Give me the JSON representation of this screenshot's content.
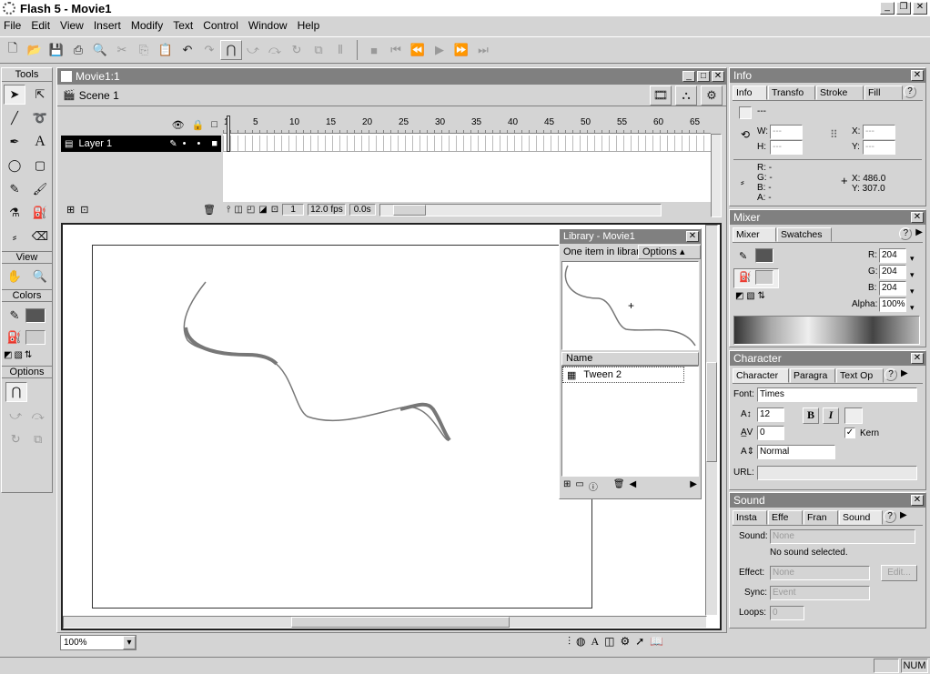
{
  "app": {
    "title": "Flash 5 - Movie1"
  },
  "menu": [
    "File",
    "Edit",
    "View",
    "Insert",
    "Modify",
    "Text",
    "Control",
    "Window",
    "Help"
  ],
  "movie": {
    "title": "Movie1:1",
    "scene": "Scene 1",
    "layer": "Layer 1",
    "frame_numbers": [
      "1",
      "5",
      "10",
      "15",
      "20",
      "25",
      "30",
      "35",
      "40",
      "45",
      "50",
      "55",
      "60",
      "65"
    ],
    "current_frame": "1",
    "fps": "12.0 fps",
    "time": "0.0s",
    "zoom": "100%"
  },
  "tools": {
    "title": "Tools",
    "view": "View",
    "colors": "Colors",
    "options": "Options"
  },
  "info": {
    "title": "Info",
    "tabs": [
      "Info",
      "Transfo",
      "Stroke",
      "Fill"
    ],
    "w_label": "W:",
    "h_label": "H:",
    "x_label": "X:",
    "y_label": "Y:",
    "w": "---",
    "h": "---",
    "x": "---",
    "y": "---",
    "r": "R: -",
    "g": "G: -",
    "b": "B: -",
    "a": "A: -",
    "cursor_x": "X: 486.0",
    "cursor_y": "Y: 307.0",
    "dash": "---"
  },
  "mixer": {
    "title": "Mixer",
    "tabs": [
      "Mixer",
      "Swatches"
    ],
    "r_label": "R:",
    "g_label": "G:",
    "b_label": "B:",
    "alpha_label": "Alpha:",
    "r": "204",
    "g": "204",
    "b": "204",
    "alpha": "100%"
  },
  "character": {
    "title": "Character",
    "tabs": [
      "Character",
      "Paragra",
      "Text Op"
    ],
    "font_label": "Font:",
    "font": "Times",
    "size": "12",
    "tracking": "0",
    "kern": "Kern",
    "style": "Normal",
    "url_label": "URL:",
    "bold": "B",
    "italic": "I"
  },
  "sound": {
    "title": "Sound",
    "tabs": [
      "Insta",
      "Effe",
      "Fran",
      "Sound"
    ],
    "sound_label": "Sound:",
    "sound_value": "None",
    "no_sound": "No sound selected.",
    "effect_label": "Effect:",
    "effect_value": "None",
    "edit_btn": "Edit...",
    "sync_label": "Sync:",
    "sync_value": "Event",
    "loops_label": "Loops:",
    "loops_value": "0"
  },
  "library": {
    "title": "Library - Movie1",
    "count": "One item in librar",
    "options": "Options",
    "name_col": "Name",
    "item": "Tween 2"
  },
  "status": {
    "num": "NUM"
  }
}
